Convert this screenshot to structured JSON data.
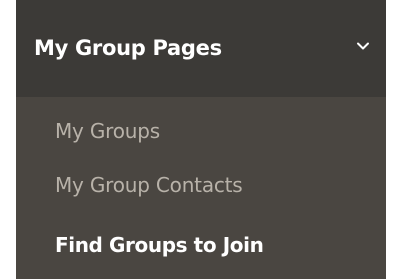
{
  "menu": {
    "title": "My Group Pages",
    "expanded": true,
    "toggle_icon": "chevron-down-icon",
    "items": [
      {
        "label": "My Groups",
        "active": false
      },
      {
        "label": "My Group Contacts",
        "active": false
      },
      {
        "label": "Find Groups to Join",
        "active": true
      }
    ]
  },
  "colors": {
    "header_bg": "#3c3a37",
    "submenu_bg": "#4a4641",
    "item_text": "#b8b2a9",
    "active_text": "#ffffff"
  }
}
